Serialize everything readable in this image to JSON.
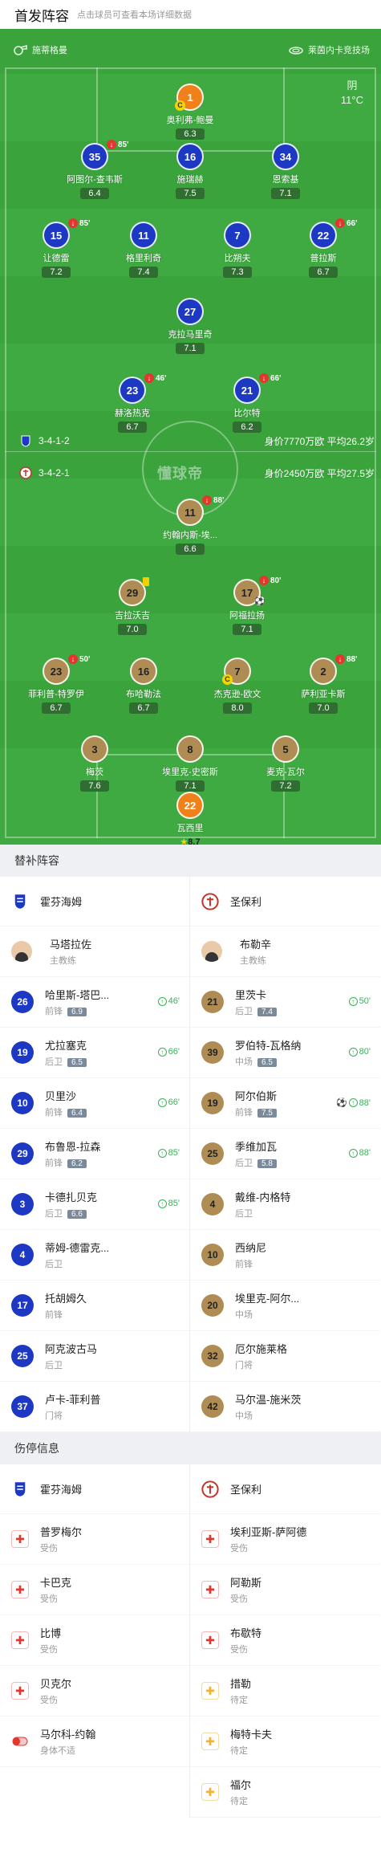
{
  "header": {
    "title": "首发阵容",
    "subtitle": "点击球员可查看本场详细数据"
  },
  "pitch": {
    "referee": "施蒂格曼",
    "venue": "莱茵内卡竞技场",
    "weather": "阴",
    "temperature": "11°C",
    "watermark": "懂球帝",
    "home_formation": "3-4-1-2",
    "home_value": "身价7770万欧 平均26.2岁",
    "away_formation": "3-4-2-1",
    "away_value": "身价2450万欧 平均27.5岁",
    "home_players": [
      {
        "num": "1",
        "name": "奥利弗-鲍曼",
        "rating": "6.3",
        "captain": true,
        "gk": true
      },
      {
        "num": "35",
        "name": "阿图尔-查韦斯",
        "rating": "6.4",
        "sub": "85'"
      },
      {
        "num": "16",
        "name": "施瑞赫",
        "rating": "7.5"
      },
      {
        "num": "34",
        "name": "恩索基",
        "rating": "7.1"
      },
      {
        "num": "15",
        "name": "让德雷",
        "rating": "7.2",
        "sub": "85'"
      },
      {
        "num": "11",
        "name": "格里利奇",
        "rating": "7.4"
      },
      {
        "num": "7",
        "name": "比朔夫",
        "rating": "7.3"
      },
      {
        "num": "22",
        "name": "普拉斯",
        "rating": "6.7",
        "sub": "66'"
      },
      {
        "num": "27",
        "name": "克拉马里奇",
        "rating": "7.1"
      },
      {
        "num": "23",
        "name": "赫洛热克",
        "rating": "6.7",
        "sub": "46'"
      },
      {
        "num": "21",
        "name": "比尔特",
        "rating": "6.2",
        "sub": "66'"
      }
    ],
    "away_players": [
      {
        "num": "11",
        "name": "约翰内斯-埃...",
        "rating": "6.6",
        "sub": "88'"
      },
      {
        "num": "29",
        "name": "吉拉沃吉",
        "rating": "7.0",
        "yellow": true
      },
      {
        "num": "17",
        "name": "阿福拉扬",
        "rating": "7.1",
        "sub": "80'",
        "goal": true
      },
      {
        "num": "23",
        "name": "菲利普-特罗伊",
        "rating": "6.7",
        "sub": "50'"
      },
      {
        "num": "16",
        "name": "布哈勒法",
        "rating": "6.7"
      },
      {
        "num": "7",
        "name": "杰克逊-欧文",
        "rating": "8.0",
        "captain": true
      },
      {
        "num": "2",
        "name": "萨利亚卡斯",
        "rating": "7.0",
        "sub": "88'"
      },
      {
        "num": "3",
        "name": "梅茨",
        "rating": "7.6"
      },
      {
        "num": "8",
        "name": "埃里克-史密斯",
        "rating": "7.1"
      },
      {
        "num": "5",
        "name": "麦克-瓦尔",
        "rating": "7.2"
      },
      {
        "num": "22",
        "name": "瓦西里",
        "rating": "8.7",
        "gk": true,
        "star": true
      }
    ]
  },
  "subs_section": {
    "title": "替补阵容"
  },
  "subs": {
    "home": {
      "team": "霍芬海姆",
      "coach": {
        "name": "马塔拉佐",
        "role": "主教练"
      },
      "players": [
        {
          "num": "26",
          "name": "哈里斯-塔巴...",
          "pos": "前锋",
          "rating": "6.9",
          "in": "46'"
        },
        {
          "num": "19",
          "name": "尤拉塞克",
          "pos": "后卫",
          "rating": "6.5",
          "in": "66'"
        },
        {
          "num": "10",
          "name": "贝里沙",
          "pos": "前锋",
          "rating": "6.4",
          "in": "66'"
        },
        {
          "num": "29",
          "name": "布鲁恩-拉森",
          "pos": "前锋",
          "rating": "6.2",
          "in": "85'"
        },
        {
          "num": "3",
          "name": "卡德扎贝克",
          "pos": "后卫",
          "rating": "6.6",
          "in": "85'"
        },
        {
          "num": "4",
          "name": "蒂姆-德雷克...",
          "pos": "后卫"
        },
        {
          "num": "17",
          "name": "托胡姆久",
          "pos": "前锋"
        },
        {
          "num": "25",
          "name": "阿克波古马",
          "pos": "后卫"
        },
        {
          "num": "37",
          "name": "卢卡-菲利普",
          "pos": "门将"
        }
      ]
    },
    "away": {
      "team": "圣保利",
      "coach": {
        "name": "布勒辛",
        "role": "主教练"
      },
      "players": [
        {
          "num": "21",
          "name": "里茨卡",
          "pos": "后卫",
          "rating": "7.4",
          "in": "50'"
        },
        {
          "num": "39",
          "name": "罗伯特-瓦格纳",
          "pos": "中场",
          "rating": "6.5",
          "in": "80'"
        },
        {
          "num": "19",
          "name": "阿尔伯斯",
          "pos": "前锋",
          "rating": "7.5",
          "in": "88'",
          "goal": true
        },
        {
          "num": "25",
          "name": "季维加瓦",
          "pos": "后卫",
          "rating": "5.8",
          "in": "88'"
        },
        {
          "num": "4",
          "name": "戴维-内格特",
          "pos": "后卫"
        },
        {
          "num": "10",
          "name": "西纳尼",
          "pos": "前锋"
        },
        {
          "num": "20",
          "name": "埃里克-阿尔...",
          "pos": "中场"
        },
        {
          "num": "32",
          "name": "厄尔施莱格",
          "pos": "门将"
        },
        {
          "num": "42",
          "name": "马尔温-施米茨",
          "pos": "中场"
        }
      ]
    }
  },
  "injury_section": {
    "title": "伤停信息"
  },
  "injuries": {
    "home": {
      "team": "霍芬海姆",
      "players": [
        {
          "name": "普罗梅尔",
          "status": "受伤",
          "icon": "injury"
        },
        {
          "name": "卡巴克",
          "status": "受伤",
          "icon": "injury"
        },
        {
          "name": "比博",
          "status": "受伤",
          "icon": "injury"
        },
        {
          "name": "贝克尔",
          "status": "受伤",
          "icon": "injury"
        },
        {
          "name": "马尔科-约翰",
          "status": "身体不适",
          "icon": "pill"
        }
      ]
    },
    "away": {
      "team": "圣保利",
      "players": [
        {
          "name": "埃利亚斯-萨阿德",
          "status": "受伤",
          "icon": "injury"
        },
        {
          "name": "阿勒斯",
          "status": "受伤",
          "icon": "injury"
        },
        {
          "name": "布歇特",
          "status": "受伤",
          "icon": "injury"
        },
        {
          "name": "措勒",
          "status": "待定",
          "icon": "pending"
        },
        {
          "name": "梅特卡夫",
          "status": "待定",
          "icon": "pending"
        },
        {
          "name": "福尔",
          "status": "待定",
          "icon": "pending"
        }
      ]
    }
  },
  "colors": {
    "pitch": "#3faa41",
    "home": "#1d39c4",
    "away": "#b08c55",
    "gk": "#f0811a"
  }
}
